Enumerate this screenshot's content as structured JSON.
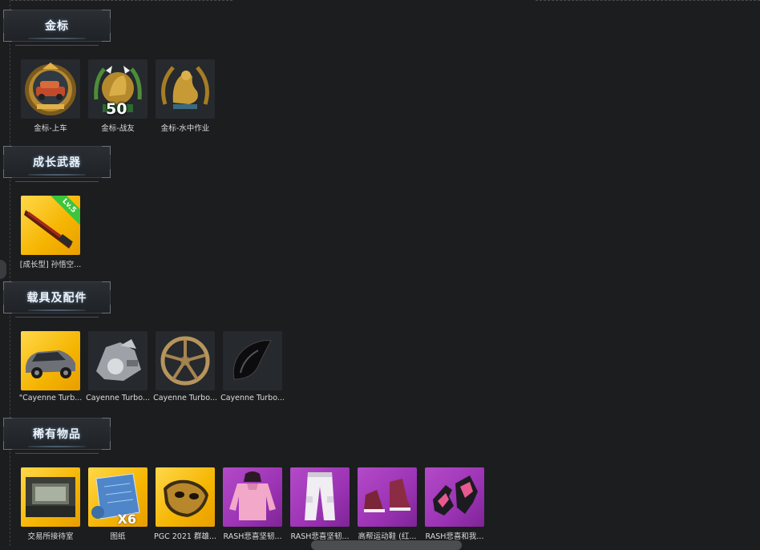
{
  "sections": [
    {
      "title": "金标",
      "items": [
        {
          "label": "金标-上车",
          "bg": "dark",
          "icon": "gold-car-emblem-icon"
        },
        {
          "label": "金标-战友",
          "bg": "dark",
          "icon": "gold-comrade-emblem-icon",
          "badge": "50"
        },
        {
          "label": "金标-水中作业",
          "bg": "dark",
          "icon": "gold-seal-emblem-icon"
        }
      ]
    },
    {
      "title": "成长武器",
      "items": [
        {
          "label": "[成长型] 孙悟空...",
          "bg": "gold",
          "icon": "shotgun-icon",
          "badge": "Lv.5"
        }
      ]
    },
    {
      "title": "载具及配件",
      "items": [
        {
          "label": "\"Cayenne Turb...",
          "bg": "gold",
          "icon": "car-icon"
        },
        {
          "label": "Cayenne Turbo...",
          "bg": "dark",
          "icon": "engine-parts-icon"
        },
        {
          "label": "Cayenne Turbo...",
          "bg": "dark",
          "icon": "wheel-rim-icon"
        },
        {
          "label": "Cayenne Turbo...",
          "bg": "dark",
          "icon": "black-fender-icon"
        }
      ]
    },
    {
      "title": "稀有物品",
      "items": [
        {
          "label": "交易所接待室",
          "bg": "gold",
          "icon": "room-icon"
        },
        {
          "label": "图纸",
          "bg": "gold",
          "icon": "blueprint-icon",
          "badge": "X6"
        },
        {
          "label": "PGC 2021 群雄...",
          "bg": "gold",
          "icon": "gold-mask-icon"
        },
        {
          "label": "RASH悲喜坚韧...",
          "bg": "purple",
          "icon": "pink-hoodie-icon"
        },
        {
          "label": "RASH悲喜坚韧...",
          "bg": "purple",
          "icon": "white-pants-icon"
        },
        {
          "label": "高帮运动鞋 (红...",
          "bg": "purple",
          "icon": "red-sneakers-icon"
        },
        {
          "label": "RASH悲喜和我...",
          "bg": "purple",
          "icon": "gloves-icon"
        }
      ]
    }
  ],
  "colors": {
    "background": "#1c1d1f",
    "gold_tile": "#f5b400",
    "purple_tile": "#9b33b4",
    "dark_tile": "#26292d",
    "level_badge": "#3cc43c"
  }
}
